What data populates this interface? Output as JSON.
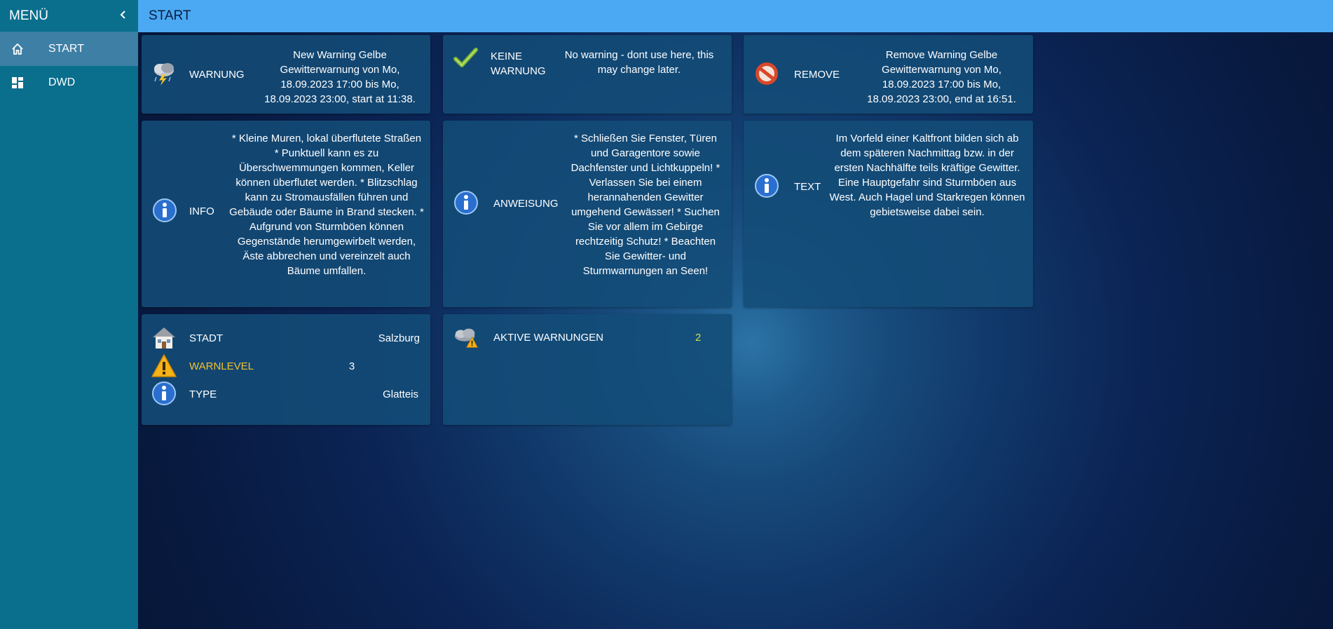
{
  "sidebar": {
    "title": "MENÜ",
    "collapse_icon": "‹",
    "items": [
      {
        "label": "START",
        "icon": "home-icon",
        "active": true
      },
      {
        "label": "DWD",
        "icon": "dashboard-icon",
        "active": false
      }
    ]
  },
  "topbar": {
    "title": "START"
  },
  "cards": {
    "warnung": {
      "icon": "thunderstorm-icon",
      "label": "WARNUNG",
      "value": "New Warning Gelbe Gewitterwarnung von Mo, 18.09.2023 17:00 bis Mo, 18.09.2023 23:00, start at 11:38."
    },
    "keine_warnung": {
      "icon": "checkmark-icon",
      "label": "KEINE WARNUNG",
      "value": "No warning - dont use here, this may change later."
    },
    "remove": {
      "icon": "no-entry-icon",
      "label": "REMOVE",
      "value": "Remove Warning Gelbe Gewitterwarnung von Mo, 18.09.2023 17:00 bis Mo, 18.09.2023 23:00, end at 16:51."
    },
    "info": {
      "icon": "info-icon",
      "label": "INFO",
      "value": "* Kleine Muren, lokal überflutete Straßen * Punktuell kann es zu Überschwemmungen kommen, Keller können überflutet werden. * Blitzschlag kann zu Stromausfällen führen und Gebäude oder Bäume in Brand stecken. * Aufgrund von Sturmböen können Gegenstände herumgewirbelt werden, Äste abbrechen und vereinzelt auch Bäume umfallen."
    },
    "anweisung": {
      "icon": "info-icon",
      "label": "ANWEISUNG",
      "value": "* Schließen Sie Fenster, Türen und Garagentore sowie Dachfenster und Lichtkuppeln! * Verlassen Sie bei einem herannahenden Gewitter umgehend Gewässer! * Suchen Sie vor allem im Gebirge rechtzeitig Schutz! * Beachten Sie Gewitter- und Sturmwarnungen an Seen!"
    },
    "text": {
      "icon": "info-icon",
      "label": "TEXT",
      "value": "Im Vorfeld einer Kaltfront bilden sich ab dem späteren Nachmittag bzw. in der ersten Nachhälfte teils kräftige Gewitter. Eine Hauptgefahr sind Sturmböen aus West. Auch Hagel und Starkregen können gebietsweise dabei sein."
    },
    "details": {
      "rows": [
        {
          "icon": "house-icon",
          "label": "STADT",
          "value": "Salzburg"
        },
        {
          "icon": "warning-icon",
          "label": "WARNLEVEL",
          "value": "3",
          "label_color": "#f2c12e"
        },
        {
          "icon": "info-icon",
          "label": "TYPE",
          "value": "Glatteis"
        }
      ]
    },
    "aktive": {
      "icon": "cloud-warning-icon",
      "label": "AKTIVE WARNUNGEN",
      "value": "2",
      "value_color": "#c9e04a"
    }
  }
}
